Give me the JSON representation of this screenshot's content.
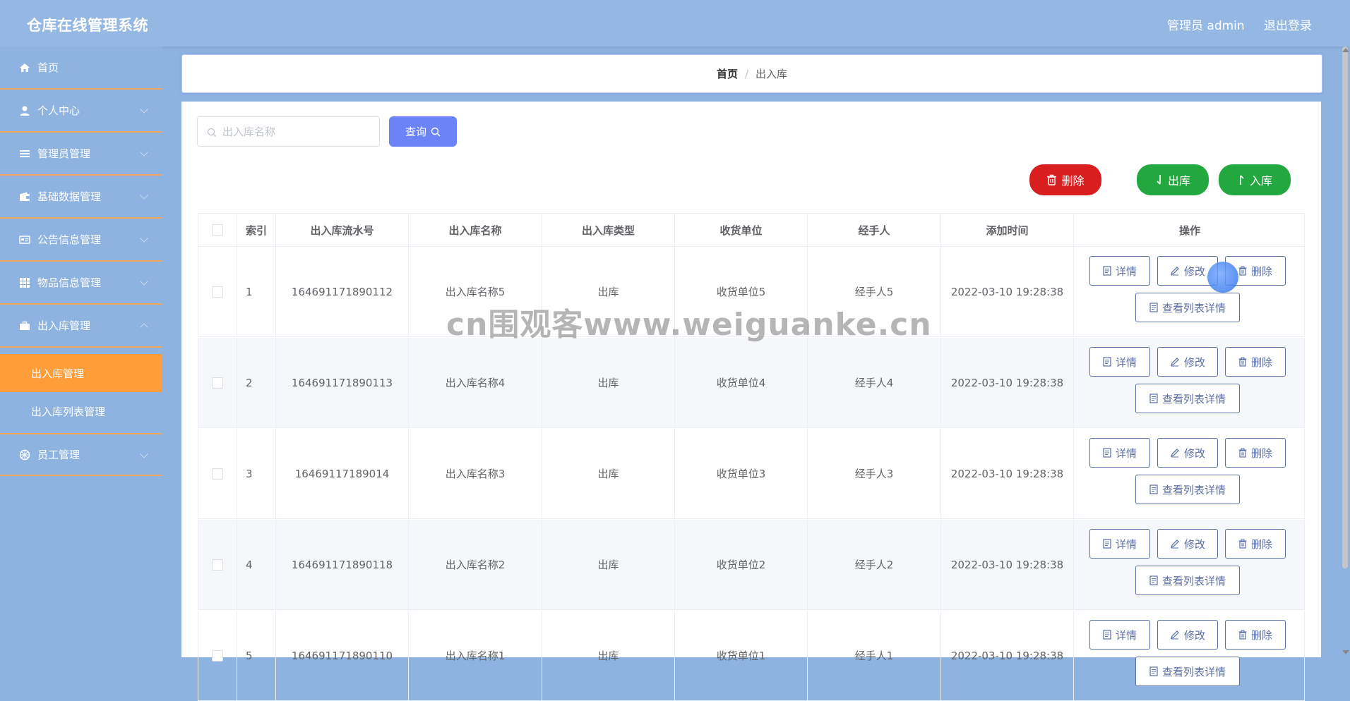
{
  "header": {
    "title": "仓库在线管理系统",
    "user": "管理员 admin",
    "logout": "退出登录"
  },
  "sidebar": {
    "items": [
      {
        "label": "首页",
        "icon": "home-icon"
      },
      {
        "label": "个人中心",
        "icon": "user-icon"
      },
      {
        "label": "管理员管理",
        "icon": "list-icon"
      },
      {
        "label": "基础数据管理",
        "icon": "wallet-icon"
      },
      {
        "label": "公告信息管理",
        "icon": "card-icon"
      },
      {
        "label": "物品信息管理",
        "icon": "grid-icon"
      },
      {
        "label": "出入库管理",
        "icon": "briefcase-icon"
      },
      {
        "label": "员工管理",
        "icon": "wheel-icon"
      }
    ],
    "submenu": [
      {
        "label": "出入库管理"
      },
      {
        "label": "出入库列表管理"
      }
    ]
  },
  "breadcrumb": {
    "home": "首页",
    "separator": "/",
    "current": "出入库"
  },
  "search": {
    "placeholder": "出入库名称",
    "button": "查询"
  },
  "actions": {
    "delete": "删除",
    "out": "出库",
    "in": "入库"
  },
  "table": {
    "headers": [
      "索引",
      "出入库流水号",
      "出入库名称",
      "出入库类型",
      "收货单位",
      "经手人",
      "添加时间",
      "操作"
    ],
    "rows": [
      {
        "index": "1",
        "serial": "164691171890112",
        "name": "出入库名称5",
        "type": "出库",
        "receiver": "收货单位5",
        "handler": "经手人5",
        "time": "2022-03-10 19:28:38"
      },
      {
        "index": "2",
        "serial": "164691171890113",
        "name": "出入库名称4",
        "type": "出库",
        "receiver": "收货单位4",
        "handler": "经手人4",
        "time": "2022-03-10 19:28:38"
      },
      {
        "index": "3",
        "serial": "16469117189014",
        "name": "出入库名称3",
        "type": "出库",
        "receiver": "收货单位3",
        "handler": "经手人3",
        "time": "2022-03-10 19:28:38"
      },
      {
        "index": "4",
        "serial": "164691171890118",
        "name": "出入库名称2",
        "type": "出库",
        "receiver": "收货单位2",
        "handler": "经手人2",
        "time": "2022-03-10 19:28:38"
      },
      {
        "index": "5",
        "serial": "164691171890110",
        "name": "出入库名称1",
        "type": "出库",
        "receiver": "收货单位1",
        "handler": "经手人1",
        "time": "2022-03-10 19:28:38"
      }
    ],
    "ops": {
      "detail": "详情",
      "edit": "修改",
      "delete": "删除",
      "list_detail": "查看列表详情"
    }
  },
  "watermark": "cn围观客www.weiguanke.cn",
  "colors": {
    "header": "#94b8e3",
    "sidebar": "#8eb3e0",
    "active": "#ff9d3a",
    "danger": "#d81e1e",
    "success": "#22a83e",
    "primary": "#6b83f5"
  }
}
